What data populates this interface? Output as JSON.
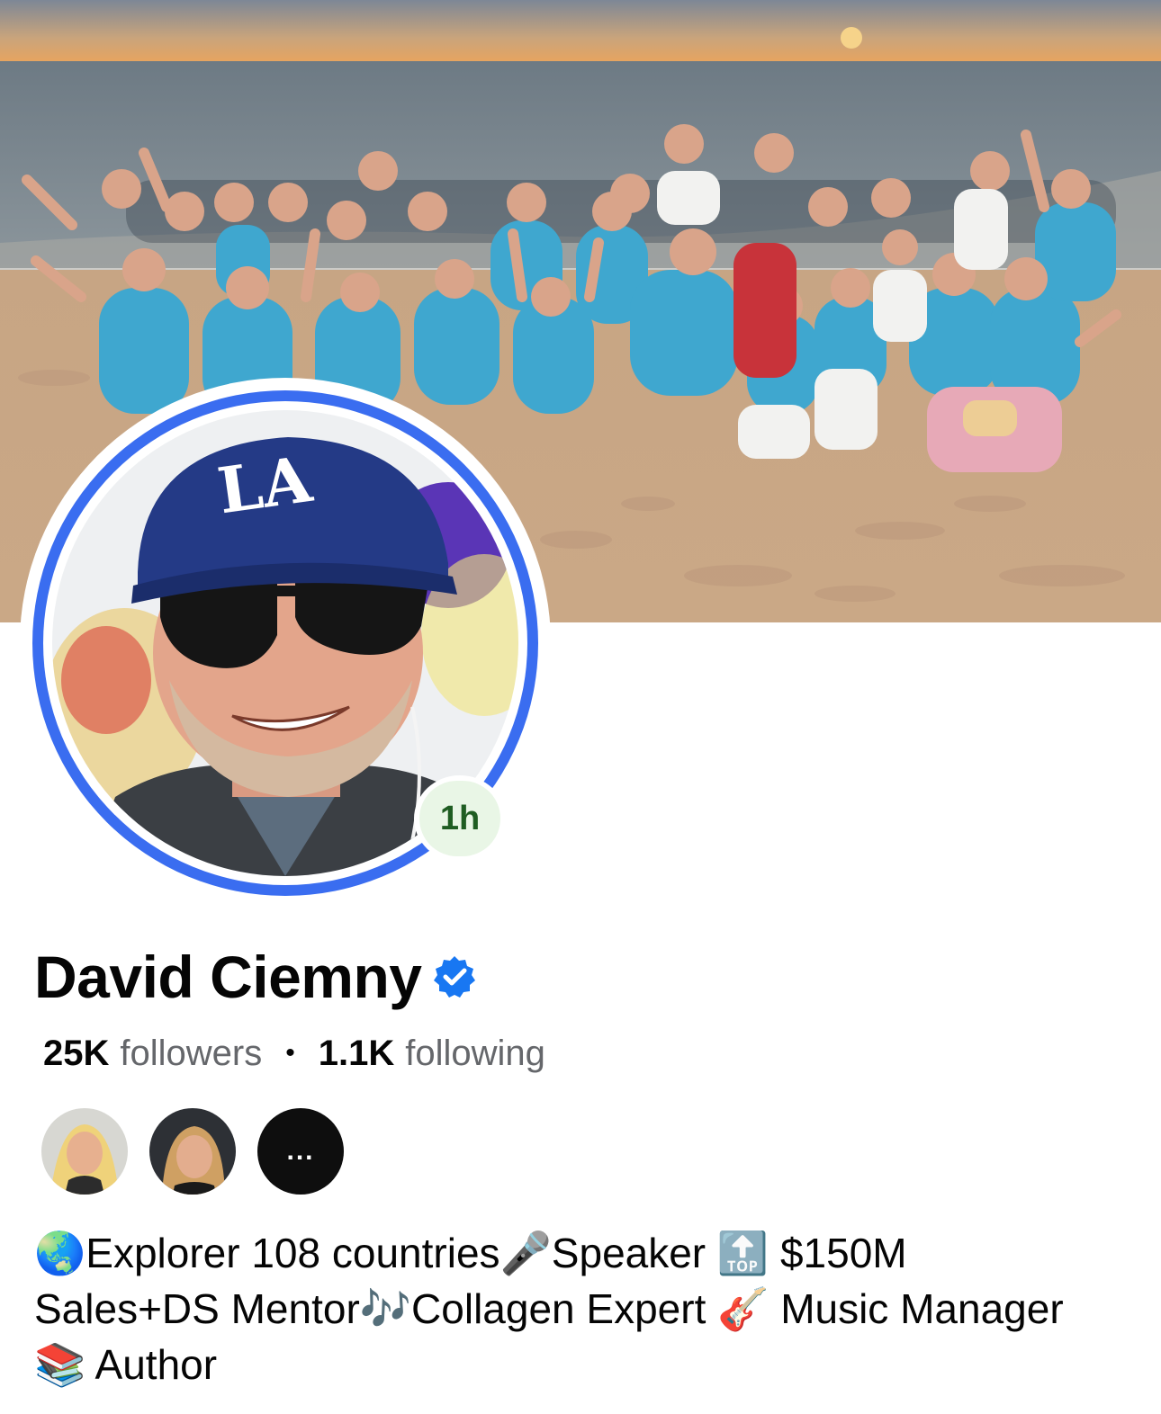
{
  "cover": {
    "icon": "beach-group-photo"
  },
  "profile": {
    "avatar_icon": "profile-photo",
    "story_age": "1h",
    "name": "David Ciemny",
    "verified_icon": "verified-badge-icon"
  },
  "stats": {
    "followers_count": "25K",
    "followers_label": "followers",
    "separator": "•",
    "following_count": "1.1K",
    "following_label": "following"
  },
  "mutuals": {
    "more_label": "..."
  },
  "bio": {
    "text": "🌏Explorer 108 countries🎤Speaker 🔝 $150M Sales+DS Mentor🎶Collagen Expert 🎸 Music Manager 📚 Author"
  },
  "colors": {
    "accent": "#3a6df0",
    "verified": "#1877f2",
    "muted_text": "#65676b",
    "story_badge_bg": "#e9f6e6",
    "story_badge_text": "#1f5d22"
  }
}
